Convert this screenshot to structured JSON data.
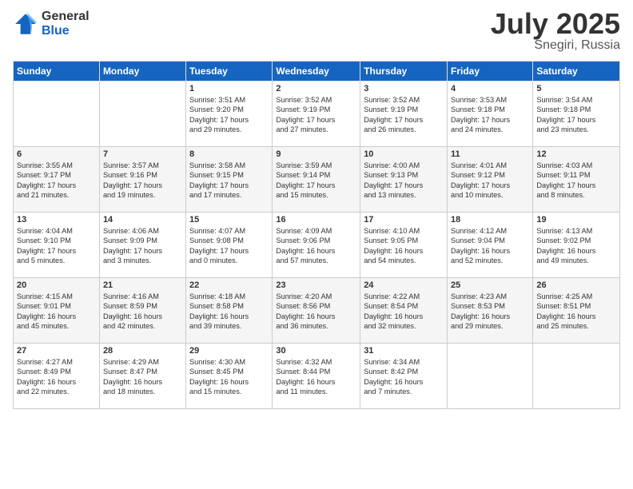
{
  "header": {
    "logo_general": "General",
    "logo_blue": "Blue",
    "month": "July 2025",
    "location": "Snegiri, Russia"
  },
  "days": [
    "Sunday",
    "Monday",
    "Tuesday",
    "Wednesday",
    "Thursday",
    "Friday",
    "Saturday"
  ],
  "weeks": [
    [
      {
        "day": "",
        "info": ""
      },
      {
        "day": "",
        "info": ""
      },
      {
        "day": "1",
        "info": "Sunrise: 3:51 AM\nSunset: 9:20 PM\nDaylight: 17 hours\nand 29 minutes."
      },
      {
        "day": "2",
        "info": "Sunrise: 3:52 AM\nSunset: 9:19 PM\nDaylight: 17 hours\nand 27 minutes."
      },
      {
        "day": "3",
        "info": "Sunrise: 3:52 AM\nSunset: 9:19 PM\nDaylight: 17 hours\nand 26 minutes."
      },
      {
        "day": "4",
        "info": "Sunrise: 3:53 AM\nSunset: 9:18 PM\nDaylight: 17 hours\nand 24 minutes."
      },
      {
        "day": "5",
        "info": "Sunrise: 3:54 AM\nSunset: 9:18 PM\nDaylight: 17 hours\nand 23 minutes."
      }
    ],
    [
      {
        "day": "6",
        "info": "Sunrise: 3:55 AM\nSunset: 9:17 PM\nDaylight: 17 hours\nand 21 minutes."
      },
      {
        "day": "7",
        "info": "Sunrise: 3:57 AM\nSunset: 9:16 PM\nDaylight: 17 hours\nand 19 minutes."
      },
      {
        "day": "8",
        "info": "Sunrise: 3:58 AM\nSunset: 9:15 PM\nDaylight: 17 hours\nand 17 minutes."
      },
      {
        "day": "9",
        "info": "Sunrise: 3:59 AM\nSunset: 9:14 PM\nDaylight: 17 hours\nand 15 minutes."
      },
      {
        "day": "10",
        "info": "Sunrise: 4:00 AM\nSunset: 9:13 PM\nDaylight: 17 hours\nand 13 minutes."
      },
      {
        "day": "11",
        "info": "Sunrise: 4:01 AM\nSunset: 9:12 PM\nDaylight: 17 hours\nand 10 minutes."
      },
      {
        "day": "12",
        "info": "Sunrise: 4:03 AM\nSunset: 9:11 PM\nDaylight: 17 hours\nand 8 minutes."
      }
    ],
    [
      {
        "day": "13",
        "info": "Sunrise: 4:04 AM\nSunset: 9:10 PM\nDaylight: 17 hours\nand 5 minutes."
      },
      {
        "day": "14",
        "info": "Sunrise: 4:06 AM\nSunset: 9:09 PM\nDaylight: 17 hours\nand 3 minutes."
      },
      {
        "day": "15",
        "info": "Sunrise: 4:07 AM\nSunset: 9:08 PM\nDaylight: 17 hours\nand 0 minutes."
      },
      {
        "day": "16",
        "info": "Sunrise: 4:09 AM\nSunset: 9:06 PM\nDaylight: 16 hours\nand 57 minutes."
      },
      {
        "day": "17",
        "info": "Sunrise: 4:10 AM\nSunset: 9:05 PM\nDaylight: 16 hours\nand 54 minutes."
      },
      {
        "day": "18",
        "info": "Sunrise: 4:12 AM\nSunset: 9:04 PM\nDaylight: 16 hours\nand 52 minutes."
      },
      {
        "day": "19",
        "info": "Sunrise: 4:13 AM\nSunset: 9:02 PM\nDaylight: 16 hours\nand 49 minutes."
      }
    ],
    [
      {
        "day": "20",
        "info": "Sunrise: 4:15 AM\nSunset: 9:01 PM\nDaylight: 16 hours\nand 45 minutes."
      },
      {
        "day": "21",
        "info": "Sunrise: 4:16 AM\nSunset: 8:59 PM\nDaylight: 16 hours\nand 42 minutes."
      },
      {
        "day": "22",
        "info": "Sunrise: 4:18 AM\nSunset: 8:58 PM\nDaylight: 16 hours\nand 39 minutes."
      },
      {
        "day": "23",
        "info": "Sunrise: 4:20 AM\nSunset: 8:56 PM\nDaylight: 16 hours\nand 36 minutes."
      },
      {
        "day": "24",
        "info": "Sunrise: 4:22 AM\nSunset: 8:54 PM\nDaylight: 16 hours\nand 32 minutes."
      },
      {
        "day": "25",
        "info": "Sunrise: 4:23 AM\nSunset: 8:53 PM\nDaylight: 16 hours\nand 29 minutes."
      },
      {
        "day": "26",
        "info": "Sunrise: 4:25 AM\nSunset: 8:51 PM\nDaylight: 16 hours\nand 25 minutes."
      }
    ],
    [
      {
        "day": "27",
        "info": "Sunrise: 4:27 AM\nSunset: 8:49 PM\nDaylight: 16 hours\nand 22 minutes."
      },
      {
        "day": "28",
        "info": "Sunrise: 4:29 AM\nSunset: 8:47 PM\nDaylight: 16 hours\nand 18 minutes."
      },
      {
        "day": "29",
        "info": "Sunrise: 4:30 AM\nSunset: 8:45 PM\nDaylight: 16 hours\nand 15 minutes."
      },
      {
        "day": "30",
        "info": "Sunrise: 4:32 AM\nSunset: 8:44 PM\nDaylight: 16 hours\nand 11 minutes."
      },
      {
        "day": "31",
        "info": "Sunrise: 4:34 AM\nSunset: 8:42 PM\nDaylight: 16 hours\nand 7 minutes."
      },
      {
        "day": "",
        "info": ""
      },
      {
        "day": "",
        "info": ""
      }
    ]
  ]
}
